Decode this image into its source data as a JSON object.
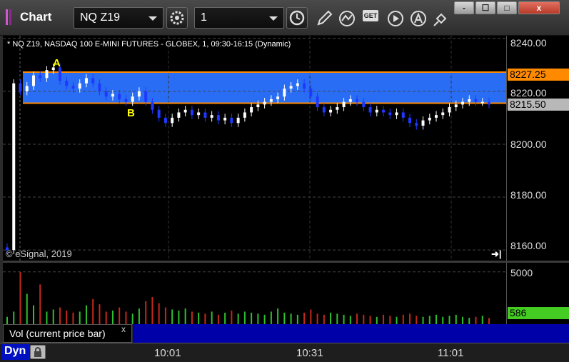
{
  "window": {
    "title": "Chart",
    "symbol": "NQ Z19",
    "interval": "1",
    "minimize": "-",
    "restore": "☐",
    "maximize": "□",
    "close": "x"
  },
  "toolbar": {
    "get_label": "GET"
  },
  "chart": {
    "header": "* NQ Z19, NASDAQ 100 E-MINI FUTURES - GLOBEX, 1, 09:30-16:15 (Dynamic)",
    "copyright": "© eSignal, 2019",
    "goto_end": "➜|",
    "label_a": "A",
    "label_b": "B",
    "price_ticks": [
      "8240.00",
      "8220.00",
      "8200.00",
      "8180.00",
      "8160.00"
    ],
    "tag_upper": "8227.25",
    "tag_lower": "8215.50",
    "zone_color": "#2a6df5",
    "line_color": "#ff8a00",
    "up_color": "#ffffff",
    "down_color": "#1e38ff"
  },
  "volume": {
    "legend": "Vol (current price bar)",
    "close_icon": "x",
    "axis_tick": "5000",
    "current": "586",
    "current_color": "#44cc22",
    "up_color": "#2fbf2f",
    "down_color": "#c4281c"
  },
  "time_axis": {
    "mode": "Dyn",
    "ticks": [
      "10:01",
      "10:31",
      "11:01"
    ]
  },
  "chart_data": {
    "type": "candlestick",
    "title": "* NQ Z19, NASDAQ 100 E-MINI FUTURES - GLOBEX, 1, 09:30-16:15 (Dynamic)",
    "yticks": [
      8240,
      8220,
      8200,
      8180,
      8160
    ],
    "ylim": [
      8156,
      8241
    ],
    "xticks": [
      "10:01",
      "10:31",
      "11:01"
    ],
    "levels": [
      8227.25,
      8215.5
    ],
    "series": [
      {
        "name": "price",
        "close": [
          8160,
          8223,
          8220,
          8222,
          8226,
          8225,
          8228,
          8229,
          8224,
          8222,
          8221,
          8223,
          8225,
          8223,
          8220,
          8218,
          8219,
          8217,
          8216,
          8218,
          8220,
          8216,
          8213,
          8210,
          8208,
          8210,
          8212,
          8213,
          8211,
          8212,
          8210,
          8211,
          8209,
          8210,
          8208,
          8210,
          8212,
          8214,
          8215,
          8216,
          8217,
          8218,
          8221,
          8222,
          8223,
          8221,
          8218,
          8214,
          8212,
          8213,
          8214,
          8216,
          8217,
          8216,
          8214,
          8212,
          8213,
          8212,
          8211,
          8212,
          8210,
          8208,
          8207,
          8209,
          8210,
          8211,
          8212,
          8214,
          8215,
          8216,
          8217,
          8216,
          8216,
          8215
        ]
      },
      {
        "name": "Vol (current price bar)",
        "values": [
          700,
          1200,
          5000,
          2900,
          1800,
          3800,
          1200,
          1400,
          1600,
          1300,
          1100,
          1200,
          1800,
          2400,
          1900,
          1200,
          1300,
          1600,
          1200,
          1000,
          1500,
          2200,
          2600,
          2000,
          1600,
          1400,
          1300,
          1500,
          1200,
          1100,
          1000,
          1200,
          900,
          1100,
          1300,
          1000,
          1200,
          1100,
          1000,
          900,
          1200,
          1500,
          1100,
          1000,
          900,
          1100,
          1400,
          1000,
          900,
          1100,
          1000,
          900,
          800,
          1000,
          900,
          800,
          700,
          900,
          800,
          700,
          900,
          1000,
          800,
          700,
          800,
          900,
          700,
          800,
          900,
          700,
          600,
          700,
          800,
          586
        ]
      }
    ],
    "volume_yticks": [
      5000
    ]
  }
}
